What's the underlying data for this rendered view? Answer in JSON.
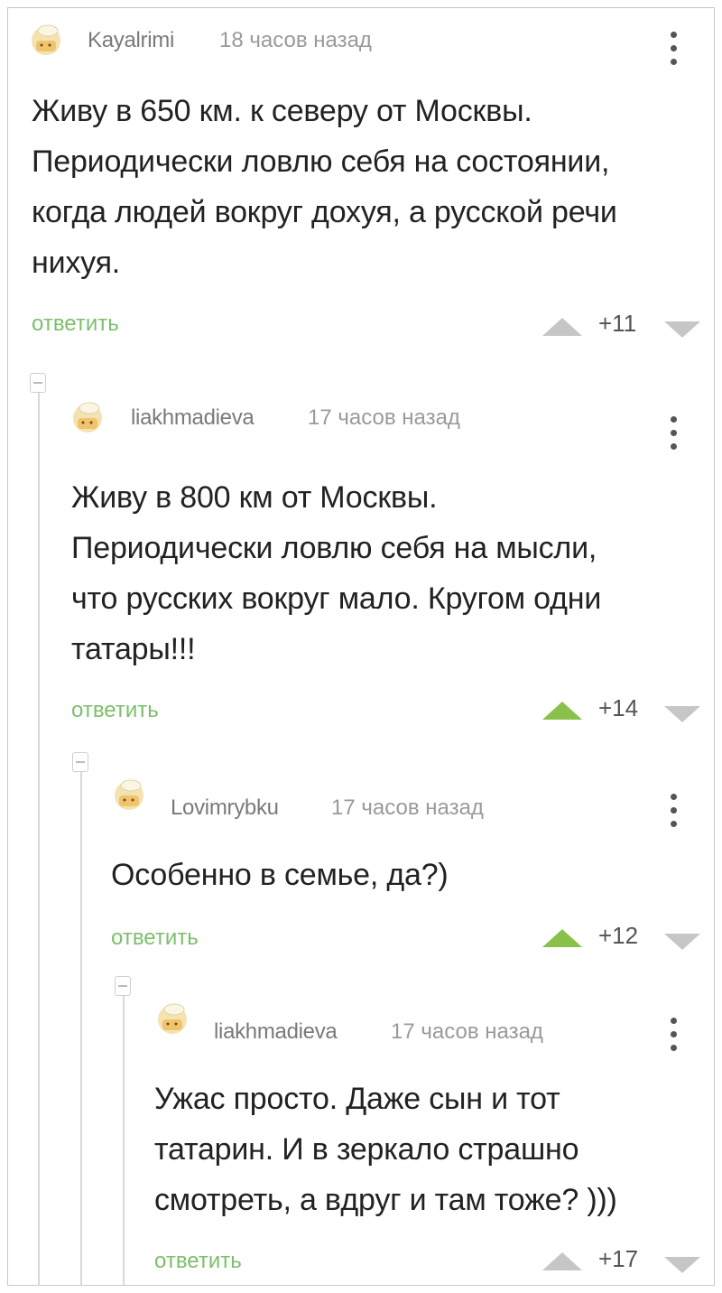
{
  "comments": [
    {
      "author": "Kayalrimi",
      "time": "18 часов назад",
      "lines": [
        "Живу в 650 км. к северу от Москвы.",
        "Периодически ловлю себя на состоянии,",
        "когда людей вокруг дохуя, а русской речи",
        "нихуя."
      ],
      "reply": "ответить",
      "score": "+11",
      "upvoted": false
    },
    {
      "author": "liakhmadieva",
      "time": "17 часов назад",
      "lines": [
        "Живу в 800 км от Москвы.",
        "Периодически ловлю себя на мысли,",
        "что русских вокруг мало. Кругом одни",
        "татары!!!"
      ],
      "reply": "ответить",
      "score": "+14",
      "upvoted": true
    },
    {
      "author": "Lovimrybku",
      "time": "17 часов назад",
      "lines": [
        "Особенно в семье, да?)"
      ],
      "reply": "ответить",
      "score": "+12",
      "upvoted": true
    },
    {
      "author": "liakhmadieva",
      "time": "17 часов назад",
      "lines": [
        "Ужас просто. Даже сын и тот",
        "татарин. И в зеркало страшно",
        "смотреть, а вдруг и там тоже? )))"
      ],
      "reply": "ответить",
      "score": "+17",
      "upvoted": false
    }
  ],
  "colors": {
    "reply_green": "#7cbf6b",
    "upvote_active": "#8ac14a",
    "inactive_arrow": "#c6c6c6"
  },
  "icons": {
    "avatar": "chef-avatar-icon",
    "menu": "kebab-menu-icon",
    "up": "upvote-arrow-icon",
    "down": "downvote-arrow-icon",
    "collapse": "collapse-thread-icon"
  }
}
